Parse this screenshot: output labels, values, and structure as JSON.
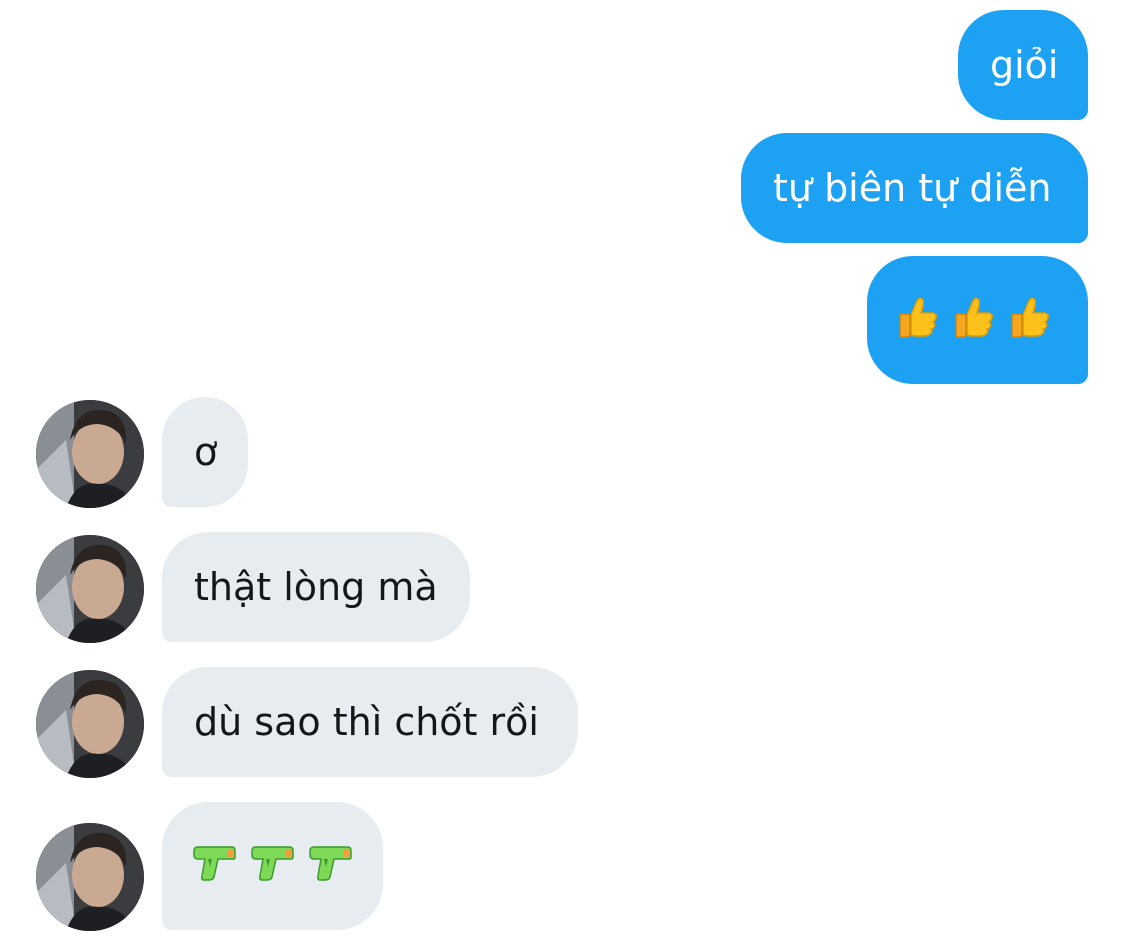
{
  "colors": {
    "outgoing_bubble": "#1da1f2",
    "incoming_bubble": "#e6ecf0",
    "outgoing_text": "#ffffff",
    "incoming_text": "#14171a"
  },
  "messages": {
    "outgoing": [
      {
        "text": "giỏi"
      },
      {
        "text": "tự biên tự diễn"
      },
      {
        "emoji": [
          "thumbs-up",
          "thumbs-up",
          "thumbs-up"
        ]
      }
    ],
    "incoming": [
      {
        "text": "ơ"
      },
      {
        "text": "thật lòng mà"
      },
      {
        "text": "dù sao thì chốt rồi"
      },
      {
        "emoji": [
          "water-pistol",
          "water-pistol",
          "water-pistol"
        ]
      }
    ]
  }
}
